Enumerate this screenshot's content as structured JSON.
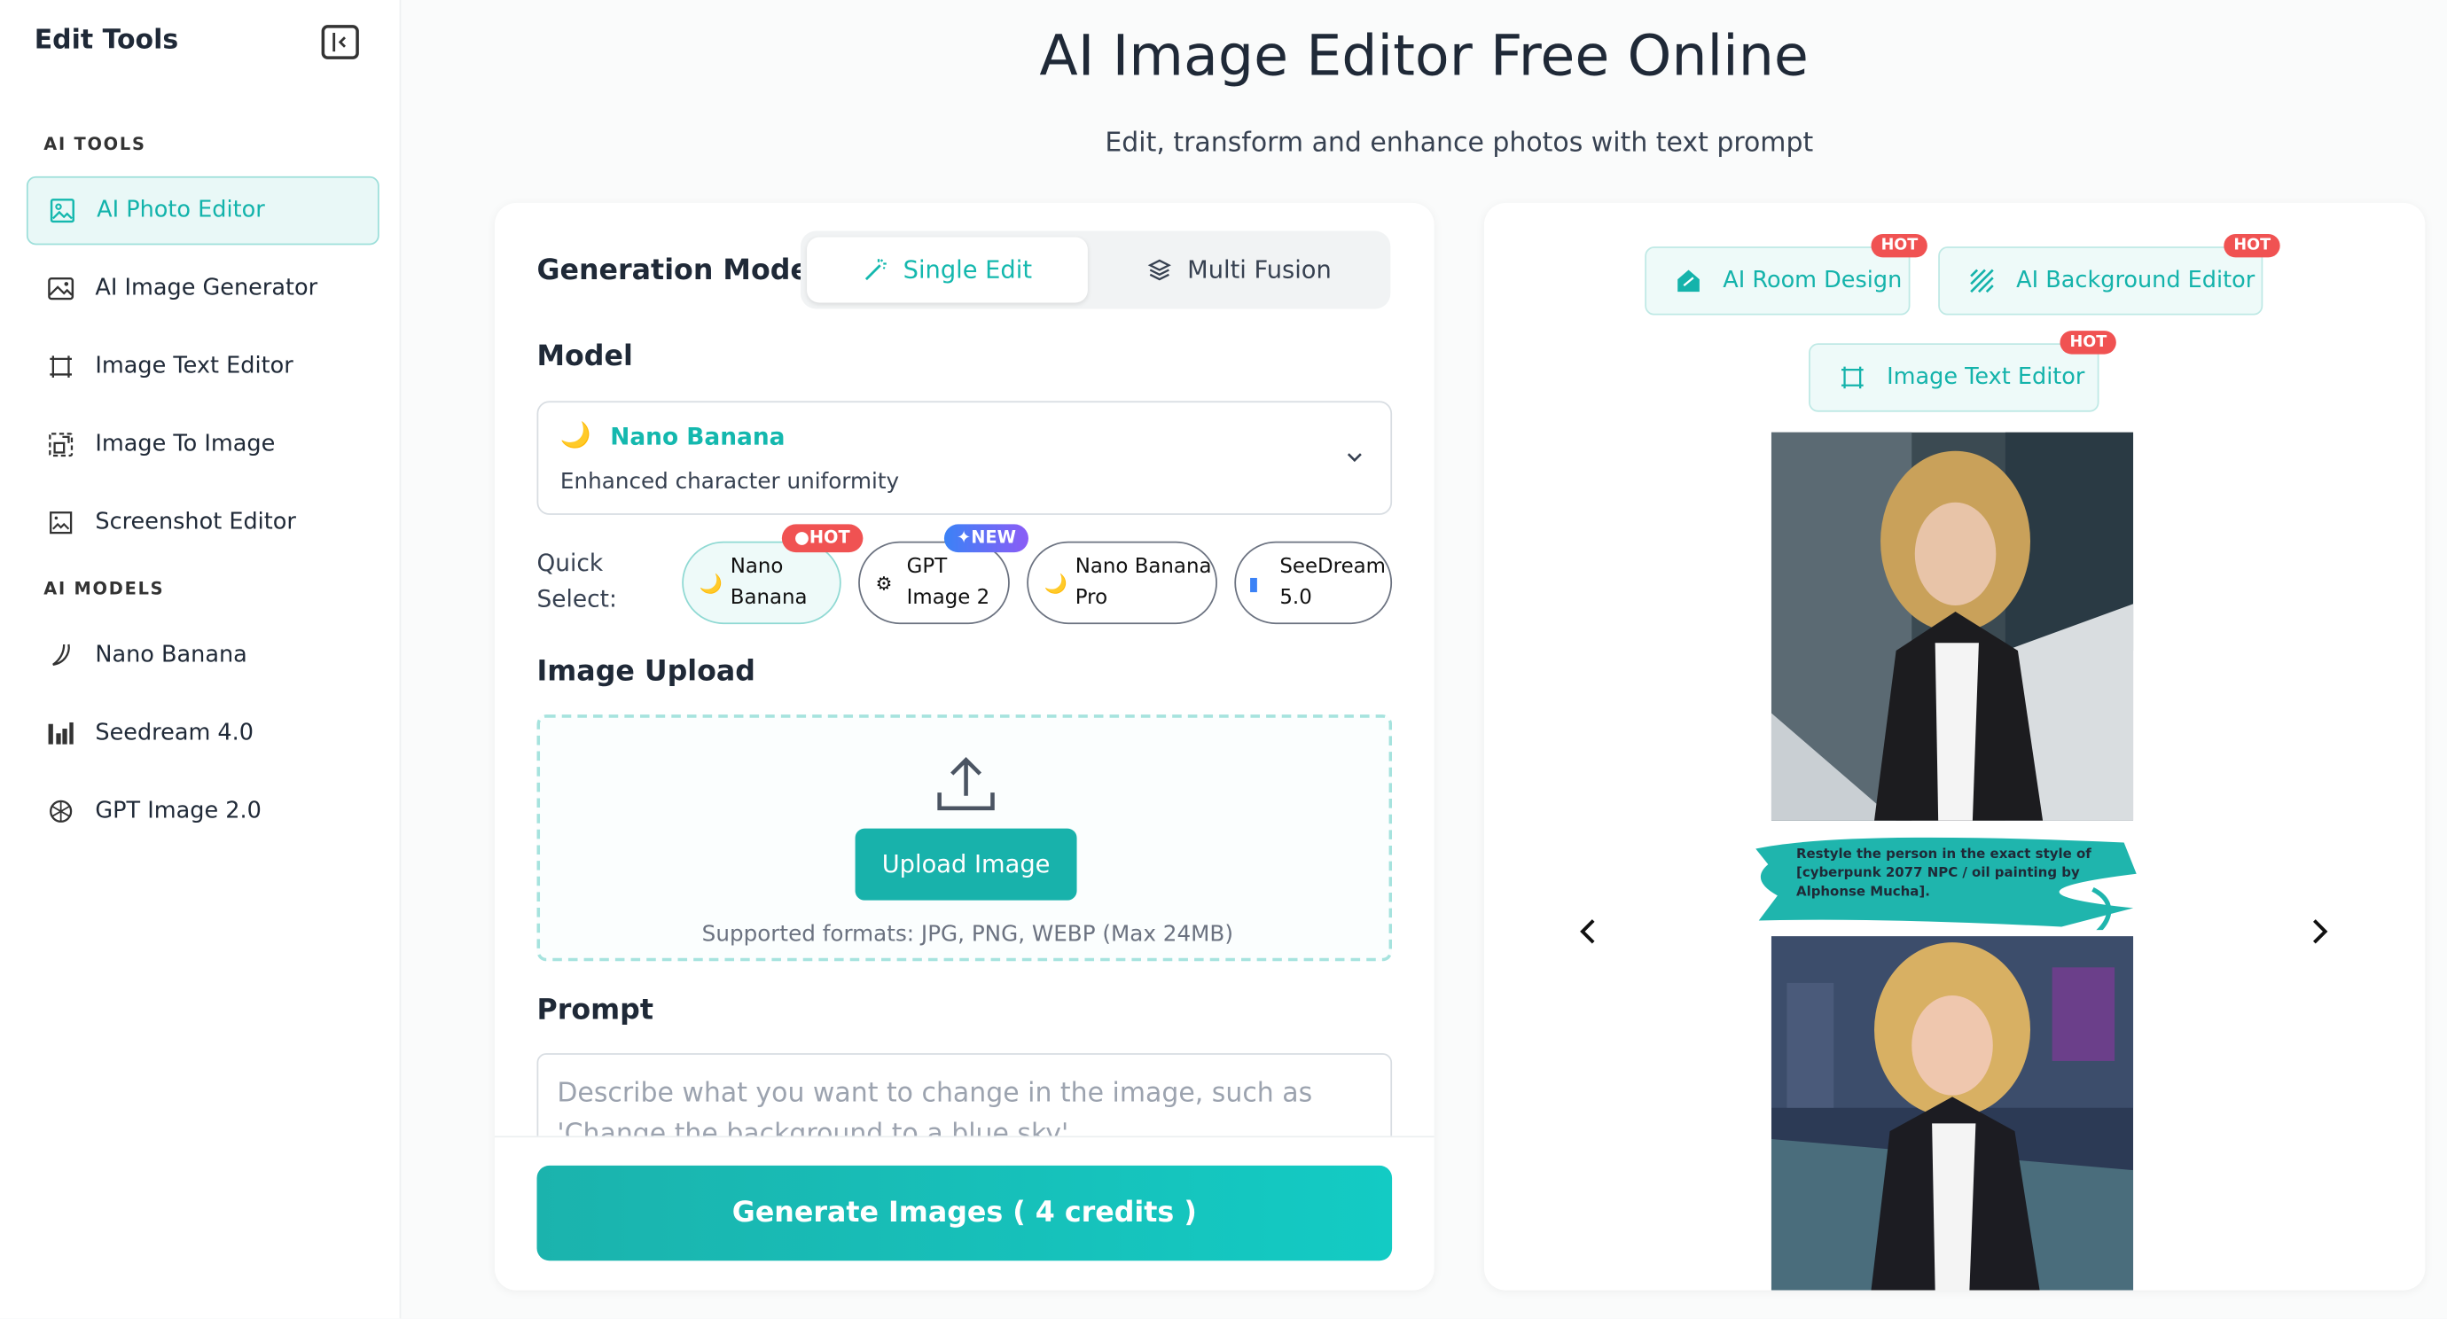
{
  "sidebar": {
    "title": "Edit Tools",
    "sections": {
      "tools": "AI TOOLS",
      "models": "AI MODELS"
    },
    "tools": [
      {
        "label": "AI Photo Editor",
        "icon": "image-icon",
        "active": true
      },
      {
        "label": "AI Image Generator",
        "icon": "landscape-icon"
      },
      {
        "label": "Image Text Editor",
        "icon": "text-frame-icon"
      },
      {
        "label": "Image To Image",
        "icon": "image-transform-icon"
      },
      {
        "label": "Screenshot Editor",
        "icon": "screenshot-icon"
      }
    ],
    "models": [
      {
        "label": "Nano Banana",
        "icon": "banana-icon"
      },
      {
        "label": "Seedream 4.0",
        "icon": "bar-chart-icon"
      },
      {
        "label": "GPT Image 2.0",
        "icon": "openai-icon"
      }
    ]
  },
  "header": {
    "title": "AI Image Editor Free Online",
    "subtitle": "Edit, transform and enhance photos with text prompt"
  },
  "form": {
    "generation_mode_label": "Generation Mode",
    "modes": {
      "single": "Single Edit",
      "multi": "Multi Fusion"
    },
    "model_label": "Model",
    "model": {
      "name": "Nano Banana",
      "description": "Enhanced character uniformity"
    },
    "quick_select_label_1": "Quick",
    "quick_select_label_2": "Select:",
    "quick_select": [
      {
        "line1": "Nano",
        "line2": "Banana",
        "badge": "HOT"
      },
      {
        "line1": "GPT",
        "line2": "Image 2",
        "badge": "NEW"
      },
      {
        "line1": "Nano Banana",
        "line2": "Pro"
      },
      {
        "line1": "SeeDream",
        "line2": "5.0"
      }
    ],
    "upload_label": "Image Upload",
    "upload_button": "Upload Image",
    "upload_note": "Supported formats: JPG, PNG, WEBP (Max 24MB)",
    "prompt_label": "Prompt",
    "prompt_placeholder": "Describe what you want to change in the image, such as 'Change the background to a blue sky'",
    "generate_button": "Generate Images ( 4 credits )"
  },
  "showcase": {
    "tools": [
      {
        "label": "AI Room Design",
        "badge": "HOT"
      },
      {
        "label": "AI Background Editor",
        "badge": "HOT"
      },
      {
        "label": "Image Text Editor",
        "badge": "HOT"
      }
    ],
    "caption": "Restyle the person in the exact style of [cyberpunk 2077 NPC / oil painting by Alphonse Mucha]."
  },
  "colors": {
    "accent": "#14b8ae",
    "hot": "#f05252"
  }
}
